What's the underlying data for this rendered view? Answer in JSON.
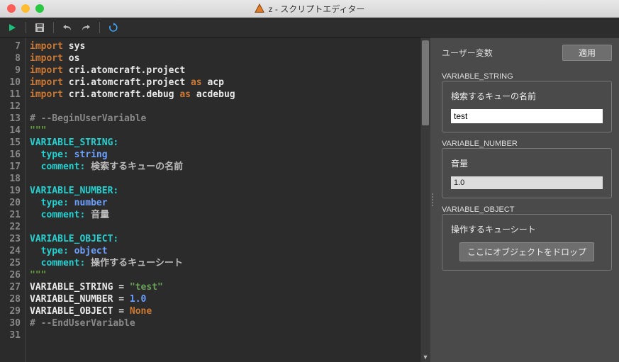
{
  "window": {
    "title": "z - スクリプトエディター"
  },
  "toolbar": {
    "run": "run",
    "save": "save",
    "undo": "undo",
    "redo": "redo",
    "reload": "reload"
  },
  "editor": {
    "first_line_no": 7,
    "lines": [
      [
        {
          "t": "import ",
          "c": "kw"
        },
        {
          "t": "sys",
          "c": "mod"
        }
      ],
      [
        {
          "t": "import ",
          "c": "kw"
        },
        {
          "t": "os",
          "c": "mod"
        }
      ],
      [
        {
          "t": "import ",
          "c": "kw"
        },
        {
          "t": "cri.atomcraft.project",
          "c": "mod"
        }
      ],
      [
        {
          "t": "import ",
          "c": "kw"
        },
        {
          "t": "cri.atomcraft.project ",
          "c": "mod"
        },
        {
          "t": "as ",
          "c": "kw"
        },
        {
          "t": "acp",
          "c": "mod"
        }
      ],
      [
        {
          "t": "import ",
          "c": "kw"
        },
        {
          "t": "cri.atomcraft.debug ",
          "c": "mod"
        },
        {
          "t": "as ",
          "c": "kw"
        },
        {
          "t": "acdebug",
          "c": "mod"
        }
      ],
      [],
      [
        {
          "t": "# --BeginUserVariable",
          "c": "cmt"
        }
      ],
      [
        {
          "t": "\"\"\"",
          "c": "doc"
        }
      ],
      [
        {
          "t": "VARIABLE_STRING:",
          "c": "key"
        }
      ],
      [
        {
          "t": "  type: ",
          "c": "key"
        },
        {
          "t": "string",
          "c": "val"
        }
      ],
      [
        {
          "t": "  comment: ",
          "c": "key"
        },
        {
          "t": "検索するキューの名前",
          "c": "ja"
        }
      ],
      [],
      [
        {
          "t": "VARIABLE_NUMBER:",
          "c": "key"
        }
      ],
      [
        {
          "t": "  type: ",
          "c": "key"
        },
        {
          "t": "number",
          "c": "val"
        }
      ],
      [
        {
          "t": "  comment: ",
          "c": "key"
        },
        {
          "t": "音量",
          "c": "ja"
        }
      ],
      [],
      [
        {
          "t": "VARIABLE_OBJECT:",
          "c": "key"
        }
      ],
      [
        {
          "t": "  type: ",
          "c": "key"
        },
        {
          "t": "object",
          "c": "val"
        }
      ],
      [
        {
          "t": "  comment: ",
          "c": "key"
        },
        {
          "t": "操作するキューシート",
          "c": "ja"
        }
      ],
      [
        {
          "t": "\"\"\"",
          "c": "doc"
        }
      ],
      [
        {
          "t": "VARIABLE_STRING ",
          "c": "eq"
        },
        {
          "t": "= ",
          "c": "eq"
        },
        {
          "t": "\"test\"",
          "c": "str"
        }
      ],
      [
        {
          "t": "VARIABLE_NUMBER ",
          "c": "eq"
        },
        {
          "t": "= ",
          "c": "eq"
        },
        {
          "t": "1.0",
          "c": "num"
        }
      ],
      [
        {
          "t": "VARIABLE_OBJECT ",
          "c": "eq"
        },
        {
          "t": "= ",
          "c": "eq"
        },
        {
          "t": "None",
          "c": "none"
        }
      ],
      [
        {
          "t": "# --EndUserVariable",
          "c": "cmt"
        }
      ],
      []
    ]
  },
  "panel": {
    "header": "ユーザー変数",
    "apply": "適用",
    "vars": [
      {
        "name": "VARIABLE_STRING",
        "comment": "検索するキューの名前",
        "kind": "string",
        "value": "test"
      },
      {
        "name": "VARIABLE_NUMBER",
        "comment": "音量",
        "kind": "number",
        "value": "1.0"
      },
      {
        "name": "VARIABLE_OBJECT",
        "comment": "操作するキューシート",
        "kind": "object",
        "drop_label": "ここにオブジェクトをドロップ"
      }
    ]
  }
}
